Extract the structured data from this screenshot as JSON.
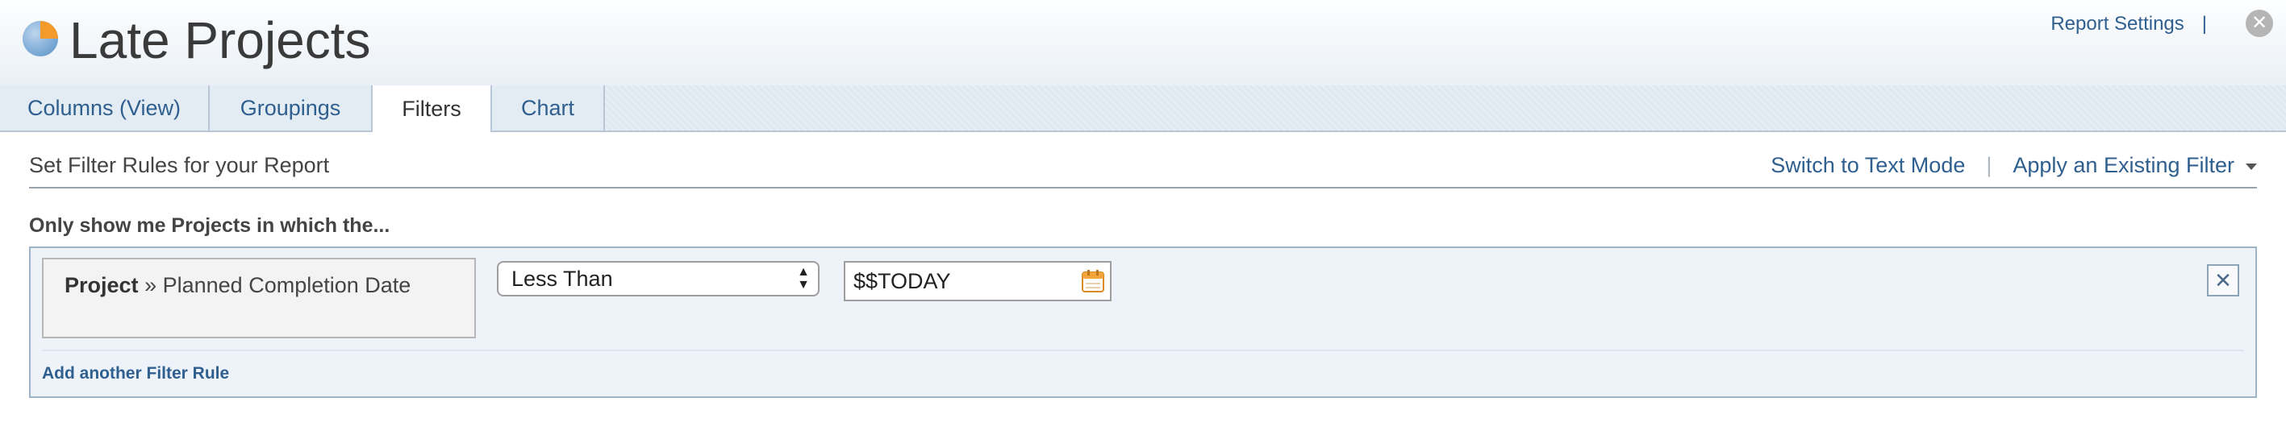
{
  "header": {
    "title": "Late Projects",
    "report_settings": "Report Settings",
    "separator": "|",
    "close_label": "✕",
    "logo_icon": "pie-chart-icon"
  },
  "tabs": [
    {
      "label": "Columns (View)",
      "active": false
    },
    {
      "label": "Groupings",
      "active": false
    },
    {
      "label": "Filters",
      "active": true
    },
    {
      "label": "Chart",
      "active": false
    }
  ],
  "filters": {
    "section_title": "Set Filter Rules for your Report",
    "switch_text_mode": "Switch to Text Mode",
    "divider": "|",
    "apply_existing": "Apply an Existing Filter",
    "intro": "Only show me Projects in which the...",
    "rule": {
      "field_object": "Project",
      "field_arrow": "»",
      "field_name": "Planned Completion Date",
      "operator": "Less Than",
      "value": "$$TODAY",
      "remove_label": "✕"
    },
    "add_rule": "Add another Filter Rule"
  },
  "colors": {
    "link": "#2f5f8f",
    "tab_bar": "#e3ebf3",
    "rule_panel": "#eef3f9",
    "logo_orange": "#f39a2b",
    "logo_blue": "#6aa2d6"
  }
}
